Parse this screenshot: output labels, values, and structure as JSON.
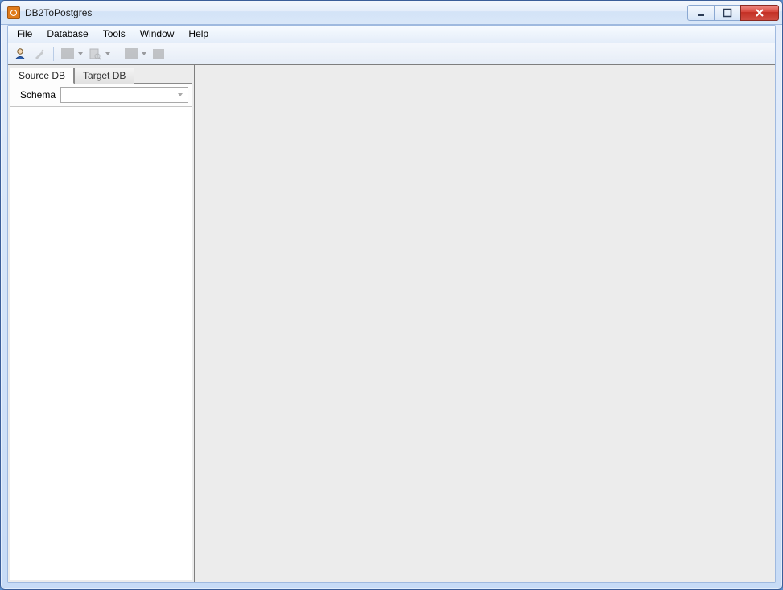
{
  "window": {
    "title": "DB2ToPostgres"
  },
  "menu": {
    "items": [
      "File",
      "Database",
      "Tools",
      "Window",
      "Help"
    ]
  },
  "toolbar": {
    "icons": [
      "connect-icon",
      "wizard-icon",
      "open-icon",
      "query-icon",
      "run-icon",
      "stop-icon"
    ]
  },
  "left_panel": {
    "tabs": [
      {
        "label": "Source DB",
        "active": true
      },
      {
        "label": "Target DB",
        "active": false
      }
    ],
    "schema_label": "Schema",
    "schema_value": ""
  }
}
